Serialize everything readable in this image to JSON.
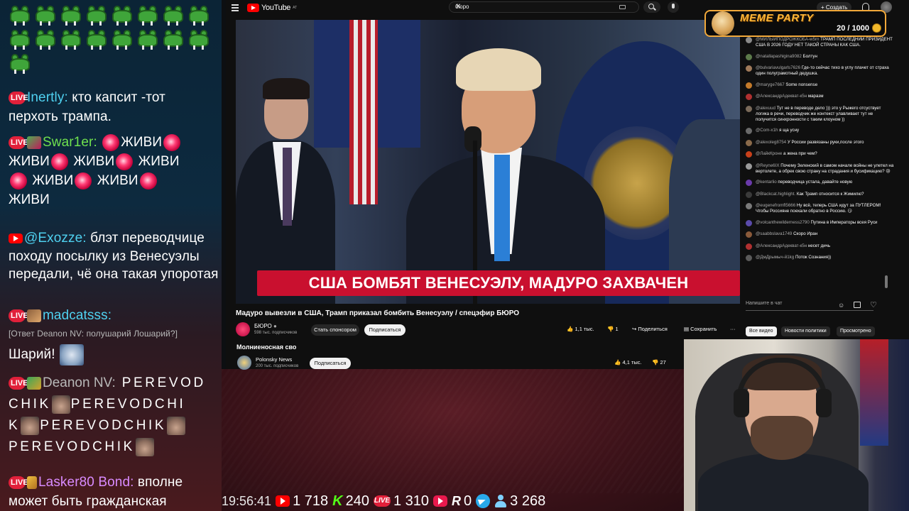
{
  "stream_chat": {
    "messages": [
      {
        "platform": "live",
        "nick": "Inertly:",
        "text": "кто капсит -тот перхоть трампа."
      },
      {
        "platform": "live",
        "nick": "Swar1er:",
        "text_parts": [
          "ЖИВИ",
          "ЖИВИ",
          "ЖИВИ",
          "ЖИВИ",
          "ЖИВИ",
          "ЖИВИ",
          "ЖИВИ"
        ]
      },
      {
        "platform": "youtube",
        "nick": "@Exozze:",
        "text": "блэт переводчице походу посылку из Венесуэлы передали, чё она такая упоротая"
      },
      {
        "platform": "live",
        "nick": "madcatsss:",
        "reply": "[Ответ Deanon NV: полушарий Лошарий?]",
        "text": "Шарий!"
      },
      {
        "platform": "live",
        "nick": "Deanon NV:",
        "text_parts": [
          "PEREVOD",
          "CHIK",
          "PEREVODCHI",
          "K",
          "PEREVODCHIK",
          "PEREVODCHIK"
        ]
      },
      {
        "platform": "live",
        "nick": "Lasker80 Bond:",
        "text": "вполне может быть гражданская"
      }
    ]
  },
  "youtube": {
    "logo": "YouTube",
    "logo_region": "AT",
    "search_value": "бюро",
    "create_label": "Создать",
    "video": {
      "caption": "США БОМБЯТ ВЕНЕСУЭЛУ, МАДУРО ЗАХВАЧЕН",
      "title": "Мадуро вывезли в США, Трамп приказал бомбить Венесуэлу / спецэфир БЮРО",
      "channel": "БЮРО",
      "subscribers": "598 тыс. подписчиков",
      "sponsor_label": "Стать спонсором",
      "subscribe_label": "Подписаться",
      "likes": "1,1 тыс.",
      "dislikes": "1",
      "share_label": "Поделиться",
      "save_label": "Сохранить"
    },
    "next_video": {
      "title": "Молниеносная сво",
      "channel": "Polonsky News",
      "subscribers": "200 тыс. подписчиков",
      "subscribe_label": "Подписаться",
      "likes": "4,1 тыс.",
      "dislikes": "27"
    },
    "tabs": [
      "Все видео",
      "Новости политики",
      "Просмотрено"
    ],
    "chat_input_placeholder": "Напишите в чат",
    "live_chat": [
      {
        "nick": "@МИЛЫЙПОДРОЖКОБА-w5rn",
        "text": "ТРАМП ПОСЛЕДНИЙ ПРИЗИДЕНТ США В 2026 ГОДУ НЕТ ТАКОЙ СТРАНЫ КАК США.",
        "color": "#8a8a8a"
      },
      {
        "nick": "@natallapashigina9082",
        "text": "Болтун",
        "color": "#5c7a4a"
      },
      {
        "nick": "@bulvariavulgarls7626",
        "text": "Где-то сейчас тихо в углу плачет от страха один полуграмотный дедушка.",
        "color": "#a07a5a"
      },
      {
        "nick": "@maryge7667",
        "text": "Some nonsense",
        "color": "#c47a2a"
      },
      {
        "nick": "@АлександрАдекват-к5н",
        "text": "маразм",
        "color": "#b03030"
      },
      {
        "nick": "@alexuud",
        "text": "Тут не в переводе дело ))) это у Рыжего отсуствует логика в речи, переводчик же контекст улавливает тут не получится синхронности с таким клоуном ))",
        "color": "#7a6a5a"
      },
      {
        "nick": "@Com-x1h",
        "text": "я ща усну",
        "color": "#6a6a6a"
      },
      {
        "nick": "@alexoleg8754",
        "text": "У России развязаны руки,после этого",
        "color": "#8a6a4a"
      },
      {
        "nick": "@ЛайкКроне",
        "text": "а жена при чем?",
        "color": "#c8401a"
      },
      {
        "nick": "@Reyne6IX",
        "text": "Почему Зеленский в самом начале войны не улетел на вертолете, а обрек свою страну на страдания и бусификацию? 😢",
        "color": "#9a9a9a"
      },
      {
        "nick": "@kentarlio",
        "text": "переводчица устала, давайте новую",
        "color": "#6a3aaa"
      },
      {
        "nick": "@Blackcat.highlight.",
        "text": "Как Трамп относится к Жимилю?",
        "color": "#3a3a3a"
      },
      {
        "nick": "@eugenefromfl5666",
        "text": "Ну всё, теперь США идут за ПУТЛЕРОМ! Чтобы Россияне поехали обратно в Россию. 😏",
        "color": "#7a7a7a"
      },
      {
        "nick": "@volcanthewilderness2790",
        "text": "Путина в Императоры всея Руси",
        "color": "#5a4aaa"
      },
      {
        "nick": "@saabbslava1749",
        "text": "Скоро Иран",
        "color": "#8a5a3a"
      },
      {
        "nick": "@АлександрАдекват-к5н",
        "text": "несет дичь",
        "color": "#b03030"
      },
      {
        "nick": "@ДмДрымыч-й1kg",
        "text": "Поток Сознания))",
        "color": "#5a5a5a"
      }
    ]
  },
  "meme_party": {
    "title": "MEME PARTY",
    "count": "20 / 1000"
  },
  "stats_bar": {
    "time": "19:56:41",
    "youtube_viewers": "1 718",
    "kick_viewers": "240",
    "vk_viewers": "1 310",
    "rutube_viewers_hidden": "",
    "r_viewers": "0",
    "total_viewers": "3 268"
  },
  "colors": {
    "youtube_red": "#ff0000",
    "caption_red": "#c9102f",
    "kick_green": "#53fc18",
    "meme_orange": "#f1a83a"
  }
}
